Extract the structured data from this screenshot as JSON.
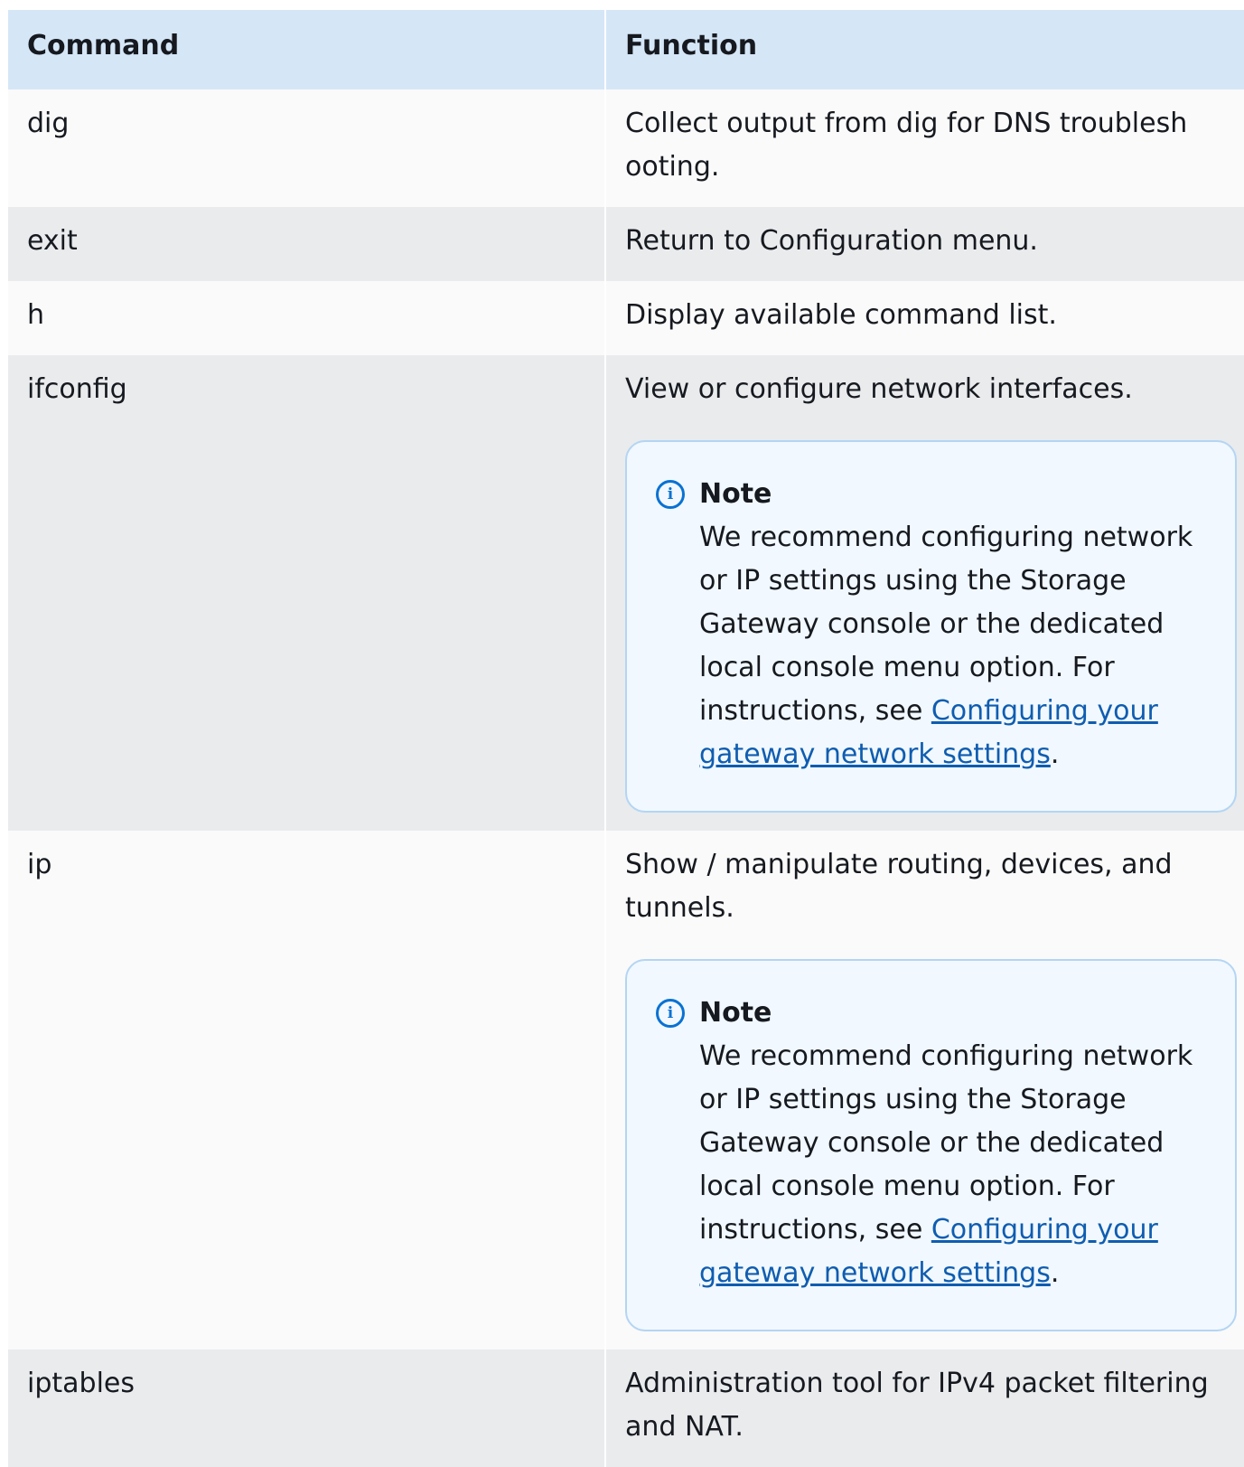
{
  "table": {
    "headers": [
      "Command",
      "Function"
    ],
    "rows": [
      {
        "command": "dig",
        "function": "Collect output from dig for DNS troublesh ooting."
      },
      {
        "command": "exit",
        "function": "Return to Configuration menu."
      },
      {
        "command": "h",
        "function": "Display available command list."
      },
      {
        "command": "ifconfig",
        "function": "View or configure network interfaces.",
        "note": {
          "title": "Note",
          "text": "We recommend configuring network or IP settings using  the Storage Gateway console or the dedicated local console menu  option. For instructions, see ",
          "link": "Configuring your gateway network   settings",
          "after": "."
        }
      },
      {
        "command": "ip",
        "function": "Show / manipulate routing, devices, and tunnels.",
        "note": {
          "title": "Note",
          "text": "We recommend configuring network or IP settings using  the Storage Gateway console or the dedicated local console menu  option. For instructions, see ",
          "link": "Configuring your gateway network   settings",
          "after": "."
        }
      },
      {
        "command": "iptables",
        "function": "Administration tool for IPv4 packet filtering and  NAT."
      }
    ]
  },
  "icons": {
    "note": "info-icon"
  },
  "colors": {
    "header_bg": "#d5e6f7",
    "note_bg": "#f1f8ff",
    "note_border": "#b4d5f3",
    "link": "#0f5db0",
    "icon": "#0972d3"
  }
}
